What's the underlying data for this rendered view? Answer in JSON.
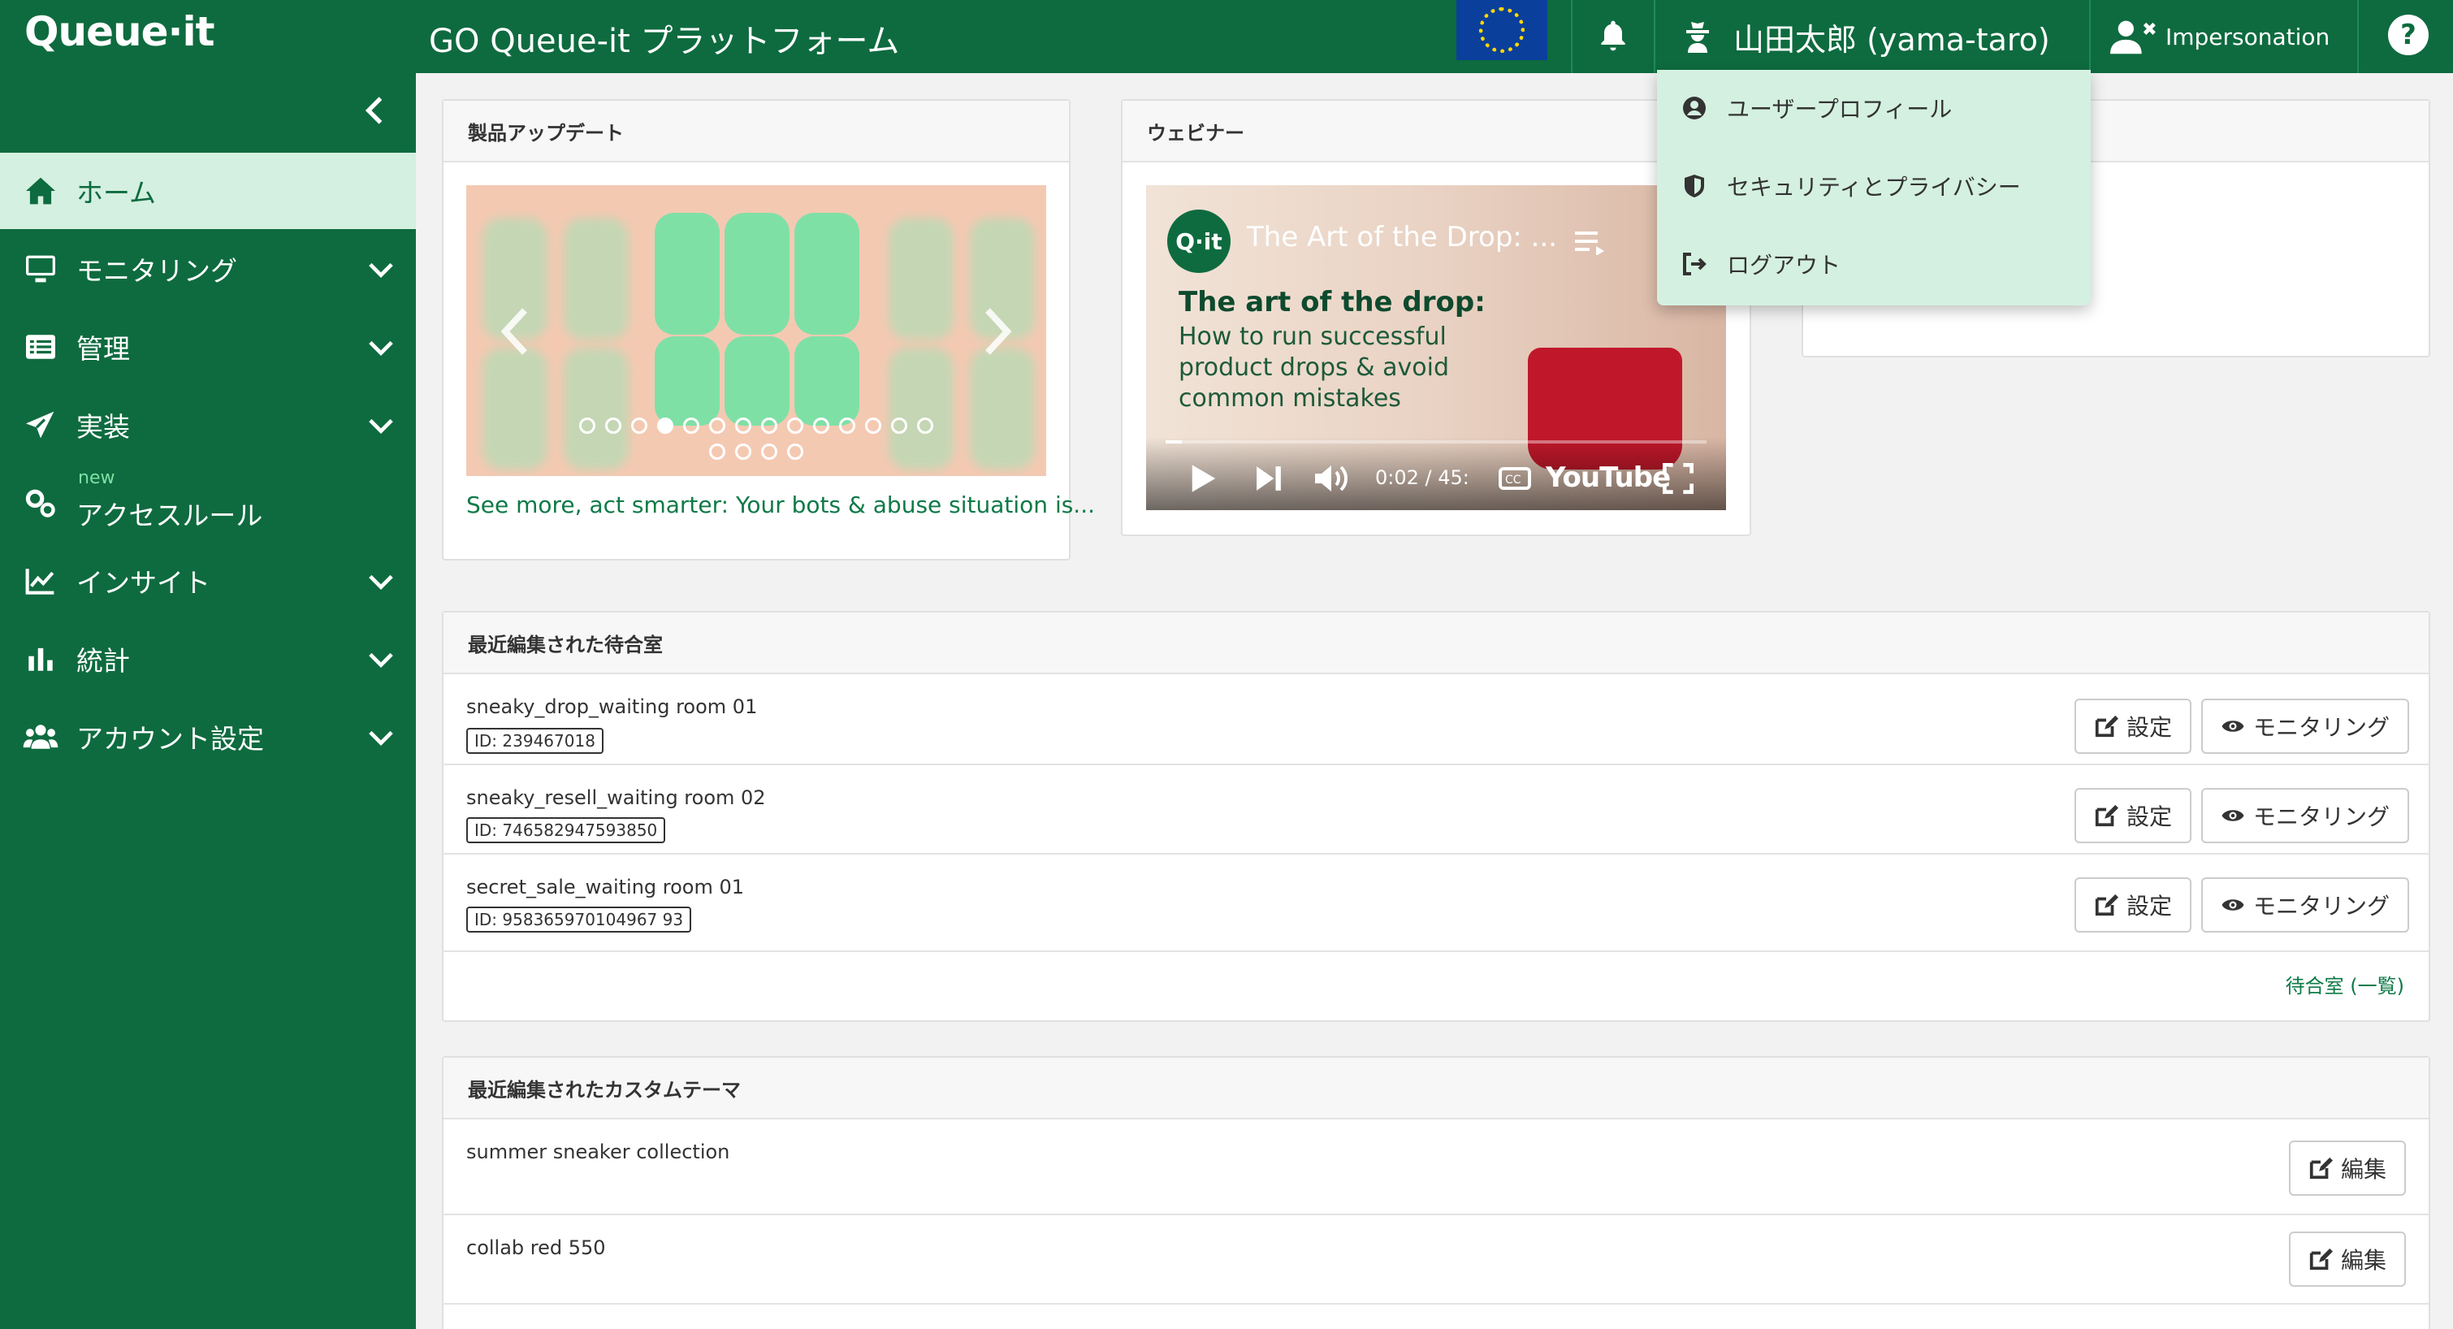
{
  "header": {
    "logo": "Queue·it",
    "title": "GO Queue-it プラットフォーム",
    "user_name": "山田太郎 (yama-taro)",
    "impersonation": "Impersonation",
    "help": "?"
  },
  "user_menu": {
    "items": [
      {
        "label": "ユーザープロフィール",
        "icon": "user-circle-icon"
      },
      {
        "label": "セキュリティとプライバシー",
        "icon": "shield-icon"
      },
      {
        "label": "ログアウト",
        "icon": "sign-out-icon"
      }
    ]
  },
  "sidebar": {
    "items": [
      {
        "label": "ホーム",
        "icon": "home-icon"
      },
      {
        "label": "モニタリング",
        "icon": "monitor-icon"
      },
      {
        "label": "管理",
        "icon": "list-icon"
      },
      {
        "label": "実装",
        "icon": "send-icon"
      },
      {
        "label": "アクセスルール",
        "icon": "gears-icon",
        "badge": "new"
      },
      {
        "label": "インサイト",
        "icon": "chart-line-icon"
      },
      {
        "label": "統計",
        "icon": "bar-chart-icon"
      },
      {
        "label": "アカウント設定",
        "icon": "users-icon"
      }
    ]
  },
  "product_updates": {
    "heading": "製品アップデート",
    "link": "See more, act smarter: Your bots & abuse situation is...",
    "active_dot": 4
  },
  "webinar": {
    "heading": "ウェビナー",
    "channel_logo": "Q·it",
    "video_title": "The Art of the Drop: ...",
    "video_heading": "The art of the drop:",
    "video_subtitle": "How to run successful product drops & avoid common mistakes",
    "time": "0:02 / 45:",
    "youtube": "YouTube"
  },
  "waiting_rooms": {
    "heading": "最近編集された待合室",
    "rows": [
      {
        "name": "sneaky_drop_waiting room 01",
        "id": "ID: 239467018"
      },
      {
        "name": "sneaky_resell_waiting room 02",
        "id": "ID: 746582947593850"
      },
      {
        "name": "secret_sale_waiting room 01",
        "id": "ID: 958365970104967 93"
      }
    ],
    "settings_label": "設定",
    "monitor_label": "モニタリング",
    "list_link": "待合室 (一覧)"
  },
  "themes": {
    "heading": "最近編集されたカスタムテーマ",
    "rows": [
      {
        "name": "summer sneaker collection"
      },
      {
        "name": "collab red 550"
      }
    ],
    "edit_label": "編集"
  },
  "colors": {
    "brand": "#0e6b3f",
    "accent_light": "#d4f0e0",
    "link": "#0e7a47"
  }
}
